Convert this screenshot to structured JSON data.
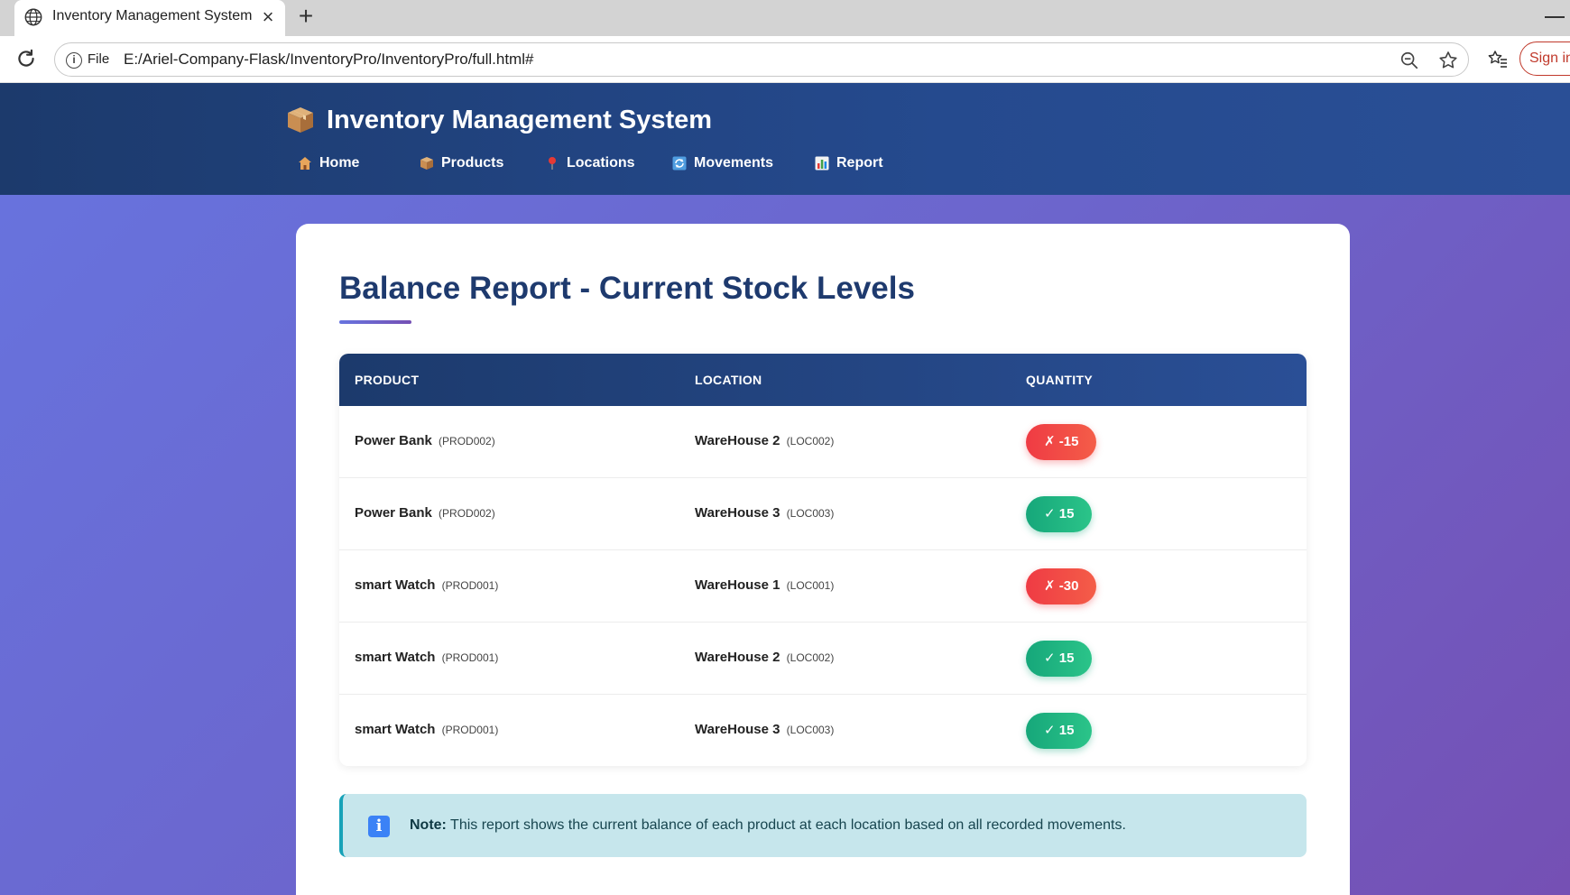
{
  "browser": {
    "tab_title": "Inventory Management System",
    "file_label": "File",
    "url": "E:/Ariel-Company-Flask/InventoryPro/InventoryPro/full.html#",
    "signin_label": "Sign in"
  },
  "header": {
    "brand_icon": "package-icon",
    "title": "Inventory Management System",
    "nav": [
      {
        "label": "Home",
        "icon": "house-icon"
      },
      {
        "label": "Products",
        "icon": "package-icon"
      },
      {
        "label": "Locations",
        "icon": "pin-icon"
      },
      {
        "label": "Movements",
        "icon": "refresh-icon"
      },
      {
        "label": "Report",
        "icon": "bar-chart-icon"
      }
    ]
  },
  "main": {
    "title": "Balance Report - Current Stock Levels",
    "table": {
      "headers": [
        "PRODUCT",
        "LOCATION",
        "QUANTITY"
      ],
      "rows": [
        {
          "product": "Power Bank",
          "product_code": "(PROD002)",
          "location": "WareHouse 2",
          "location_code": "(LOC002)",
          "quantity": "✗ -15",
          "status": "negative"
        },
        {
          "product": "Power Bank",
          "product_code": "(PROD002)",
          "location": "WareHouse 3",
          "location_code": "(LOC003)",
          "quantity": "✓ 15",
          "status": "positive"
        },
        {
          "product": "smart Watch",
          "product_code": "(PROD001)",
          "location": "WareHouse 1",
          "location_code": "(LOC001)",
          "quantity": "✗ -30",
          "status": "negative"
        },
        {
          "product": "smart Watch",
          "product_code": "(PROD001)",
          "location": "WareHouse 2",
          "location_code": "(LOC002)",
          "quantity": "✓ 15",
          "status": "positive"
        },
        {
          "product": "smart Watch",
          "product_code": "(PROD001)",
          "location": "WareHouse 3",
          "location_code": "(LOC003)",
          "quantity": "✓ 15",
          "status": "positive"
        }
      ]
    },
    "note": {
      "label": "Note:",
      "text": "This report shows the current balance of each product at each location based on all recorded movements.",
      "icon": "info-icon"
    }
  },
  "colors": {
    "header": "#1c3a6c",
    "title": "#1e3a6e",
    "negative": "#ef3b44",
    "positive": "#16a77a",
    "note_bg": "#c6e6ec"
  }
}
